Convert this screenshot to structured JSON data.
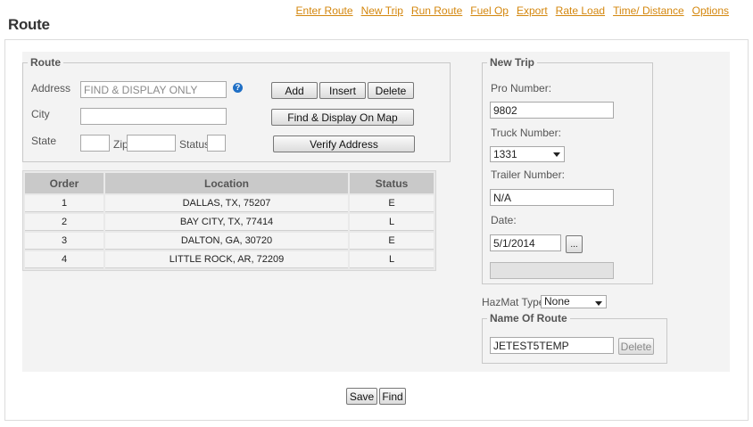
{
  "page": {
    "title": "Route"
  },
  "nav": [
    "Enter Route",
    "New Trip",
    "Run Route",
    "Fuel Op",
    "Export",
    "Rate Load",
    "Time/ Distance",
    "Options"
  ],
  "route_form": {
    "legend": "Route",
    "address_label": "Address",
    "address_value": "FIND & DISPLAY ONLY",
    "city_label": "City",
    "city_value": "",
    "state_label": "State",
    "state_value": "",
    "zip_label": "Zip",
    "zip_value": "",
    "status_label": "Status",
    "status_value": "",
    "help_glyph": "?",
    "add_label": "Add",
    "insert_label": "Insert",
    "delete_label": "Delete",
    "find_display_label": "Find & Display On Map",
    "verify_label": "Verify Address"
  },
  "stops_table": {
    "columns": [
      "Order",
      "Location",
      "Status"
    ],
    "rows": [
      {
        "order": "1",
        "location": "DALLAS, TX, 75207",
        "status": "E"
      },
      {
        "order": "2",
        "location": "BAY CITY, TX, 77414",
        "status": "L"
      },
      {
        "order": "3",
        "location": "DALTON, GA, 30720",
        "status": "E"
      },
      {
        "order": "4",
        "location": "LITTLE ROCK, AR, 72209",
        "status": "L"
      }
    ]
  },
  "new_trip": {
    "legend": "New Trip",
    "pro_number_label": "Pro Number:",
    "pro_number_value": "9802",
    "truck_number_label": "Truck Number:",
    "truck_number_value": "1331",
    "trailer_number_label": "Trailer Number:",
    "trailer_number_value": "N/A",
    "date_label": "Date:",
    "date_value": "5/1/2014",
    "date_picker_label": "...",
    "extra_field_value": ""
  },
  "hazmat": {
    "label": "HazMat Type",
    "value": "None"
  },
  "route_name": {
    "legend": "Name Of Route",
    "value": "JETEST5TEMP",
    "delete_label": "Delete"
  },
  "footer": {
    "save_label": "Save",
    "find_label": "Find"
  }
}
